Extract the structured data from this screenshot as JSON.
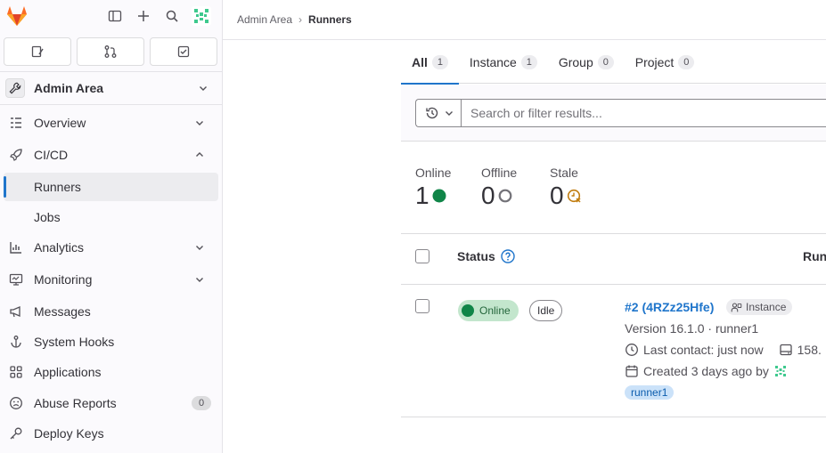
{
  "sidebar": {
    "context_title": "Admin Area",
    "items": [
      {
        "label": "Overview"
      },
      {
        "label": "CI/CD"
      },
      {
        "label": "Runners"
      },
      {
        "label": "Jobs"
      },
      {
        "label": "Analytics"
      },
      {
        "label": "Monitoring"
      },
      {
        "label": "Messages"
      },
      {
        "label": "System Hooks"
      },
      {
        "label": "Applications"
      },
      {
        "label": "Abuse Reports",
        "count": "0"
      },
      {
        "label": "Deploy Keys"
      }
    ]
  },
  "breadcrumb": {
    "parent": "Admin Area",
    "separator": "›",
    "current": "Runners"
  },
  "tabs": [
    {
      "label": "All",
      "count": "1"
    },
    {
      "label": "Instance",
      "count": "1"
    },
    {
      "label": "Group",
      "count": "0"
    },
    {
      "label": "Project",
      "count": "0"
    }
  ],
  "search": {
    "placeholder": "Search or filter results..."
  },
  "stats": [
    {
      "label": "Online",
      "value": "1"
    },
    {
      "label": "Offline",
      "value": "0"
    },
    {
      "label": "Stale",
      "value": "0"
    }
  ],
  "table": {
    "headers": {
      "status": "Status",
      "runner": "Runner"
    },
    "rows": [
      {
        "status": "Online",
        "state": "Idle",
        "runner_name": "#2 (4RZz25Hfe)",
        "type_badge": "Instance",
        "version": "Version 16.1.0 · runner1",
        "last_contact": "Last contact: just now",
        "ip_partial": "158.",
        "created": "Created 3 days ago by",
        "tag": "runner1"
      }
    ]
  },
  "colors": {
    "accent": "#1f75cb",
    "online": "#108548",
    "stale": "#c17d10"
  }
}
